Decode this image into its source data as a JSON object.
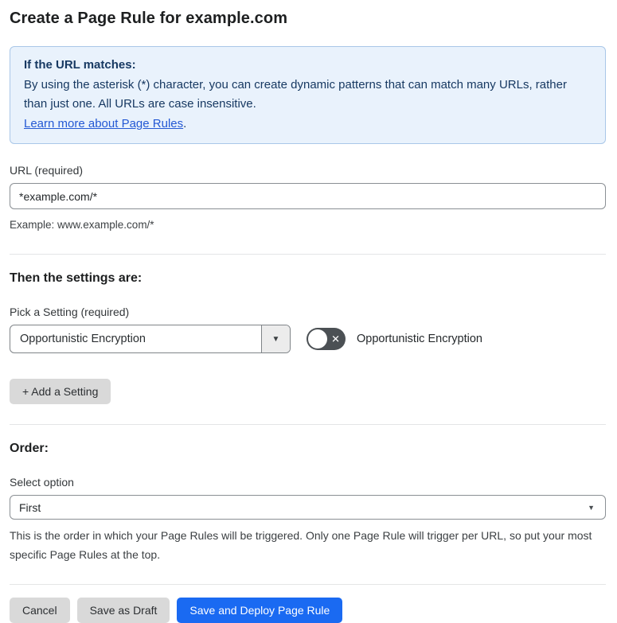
{
  "page": {
    "title": "Create a Page Rule for example.com"
  },
  "info_box": {
    "heading": "If the URL matches:",
    "body": "By using the asterisk (*) character, you can create dynamic patterns that can match many URLs, rather than just one. All URLs are case insensitive.",
    "link_label": "Learn more about Page Rules",
    "link_suffix": "."
  },
  "url_field": {
    "label": "URL (required)",
    "value": "*example.com/*",
    "helper": "Example: www.example.com/*"
  },
  "settings_section": {
    "heading": "Then the settings are:",
    "setting_label": "Pick a Setting (required)",
    "setting_value": "Opportunistic Encryption",
    "toggle": {
      "state": "off",
      "label": "Opportunistic Encryption"
    },
    "add_button_label": "+ Add a Setting"
  },
  "order_section": {
    "heading": "Order:",
    "select_label": "Select option",
    "select_value": "First",
    "helper": "This is the order in which your Page Rules will be triggered. Only one Page Rule will trigger per URL, so put your most specific Page Rules at the top."
  },
  "footer": {
    "cancel_label": "Cancel",
    "save_draft_label": "Save as Draft",
    "save_deploy_label": "Save and Deploy Page Rule"
  },
  "icons": {
    "select_caret": "▼",
    "toggle_off_glyph": "✕"
  },
  "colors": {
    "primary_button_blue": "#1a6af2",
    "link_blue": "#2358d4",
    "info_box_background": "#e9f2fc",
    "info_box_border": "#a9c7e8",
    "info_box_text": "#173962",
    "toggle_off_background": "#4b5054",
    "gray_button_background": "#d9d9d9"
  }
}
